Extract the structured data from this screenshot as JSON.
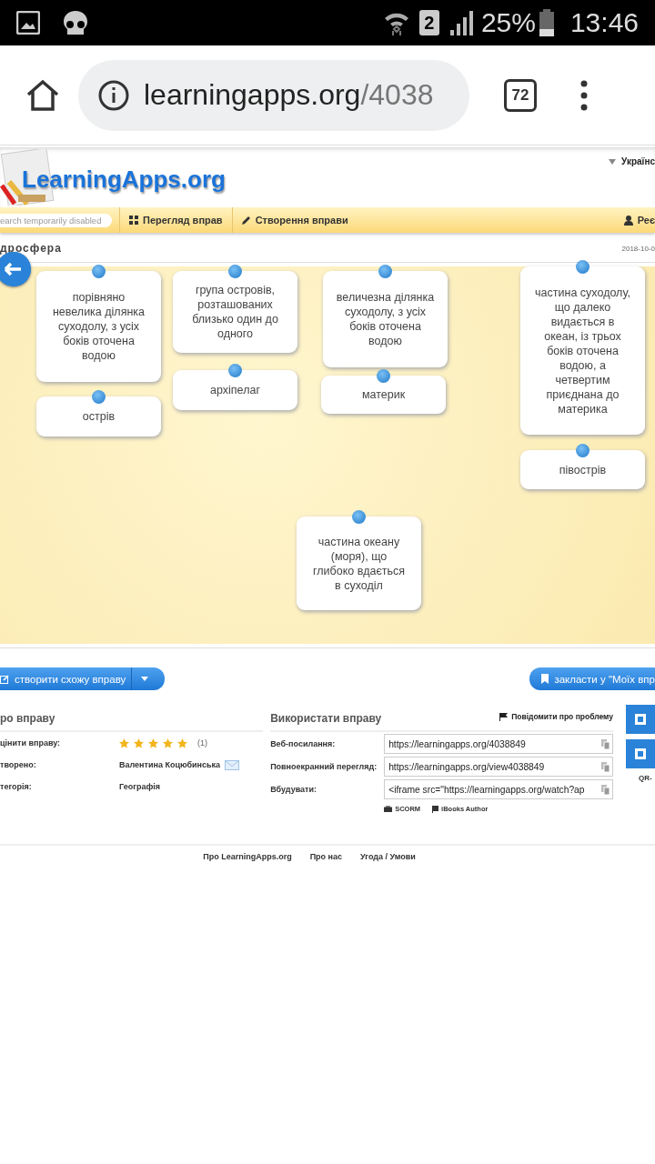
{
  "status_bar": {
    "sim": "2",
    "battery": "25%",
    "time": "13:46"
  },
  "browser": {
    "url_host": "learningapps.org",
    "url_path": "/4038",
    "tab_count": "72"
  },
  "site": {
    "logo": "LearningApps.org",
    "language": "Українс",
    "search_placeholder": "earch temporarily disabled",
    "nav": [
      {
        "label": "Перегляд вправ",
        "kind": "grid"
      },
      {
        "label": "Створення вправи",
        "kind": "pencil"
      },
      {
        "label": "Реє",
        "kind": "user"
      }
    ]
  },
  "exercise": {
    "title": "дросфера",
    "date": "2018-10-0",
    "cards": [
      {
        "text": "порівняно невелика ділянка суходолу, з усіх боків оточена водою"
      },
      {
        "text": "острів"
      },
      {
        "text": "група островів, розташованих близько один до одного"
      },
      {
        "text": "архіпелаг"
      },
      {
        "text": "величезна ділянка суходолу, з усіх боків оточена водою"
      },
      {
        "text": "материк"
      },
      {
        "text": "частина суходолу, що далеко видається в океан, із трьох боків оточена водою, а четвертим приєднана до материка"
      },
      {
        "text": "півострів"
      },
      {
        "text": "частина океану (моря), що глибоко вдається в суходіл"
      }
    ]
  },
  "actions": {
    "create_similar": "створити схожу вправу",
    "bookmark": "закласти у \"Моїх впр"
  },
  "about": {
    "heading": "ро вправу",
    "rows": [
      {
        "label": "цінити вправу:",
        "kind": "rating",
        "stars": 5,
        "count": "(1)"
      },
      {
        "label": "творено:",
        "kind": "author",
        "value": "Валентина Коцюбинська"
      },
      {
        "label": "тегорія:",
        "kind": "text",
        "value": "Географія"
      }
    ]
  },
  "use": {
    "heading": "Використати вправу",
    "report": "Повідомити про проблему",
    "fields": [
      {
        "label": "Веб-посилання:",
        "value": "https://learningapps.org/4038849"
      },
      {
        "label": "Повноекранний перегляд:",
        "value": "https://learningapps.org/view4038849"
      },
      {
        "label": "Вбудувати:",
        "value": "<iframe src=\"https://learningapps.org/watch?ap"
      }
    ],
    "exports": [
      {
        "label": "SCORM",
        "kind": "briefcase"
      },
      {
        "label": "iBooks Author",
        "kind": "book"
      }
    ],
    "qr_label": "QR-"
  },
  "footer": [
    "Про LearningApps.org",
    "Про нас",
    "Угода / Умови"
  ]
}
